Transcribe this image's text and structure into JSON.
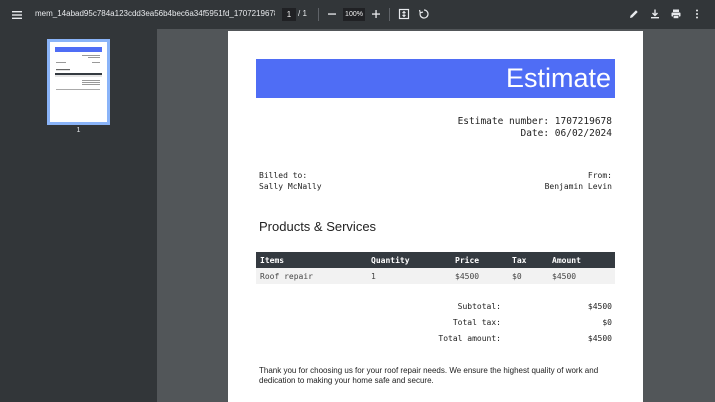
{
  "toolbar": {
    "file_name": "mem_14abad95c784a123cdd3ea56b4bec6a34f5951fd_1707219678...",
    "current_page": "1",
    "page_total": "/ 1",
    "zoom": "100%"
  },
  "sidebar": {
    "thumbnail_label": "1"
  },
  "document": {
    "title": "Estimate",
    "estimate_number_line": "Estimate number: 1707219678",
    "date_line": "Date: 06/02/2024",
    "billed_to_label": "Billed to:",
    "billed_to_name": "Sally McNally",
    "from_label": "From:",
    "from_name": "Benjamin Levin",
    "section_title": "Products & Services",
    "table": {
      "headers": [
        "Items",
        "Quantity",
        "Price",
        "Tax",
        "Amount"
      ],
      "rows": [
        [
          "Roof repair",
          "1",
          "$4500",
          "$0",
          "$4500"
        ]
      ]
    },
    "totals": {
      "subtotal_label": "Subtotal:",
      "subtotal_value": "$4500",
      "tax_label": "Total tax:",
      "tax_value": "$0",
      "amount_label": "Total amount:",
      "amount_value": "$4500"
    },
    "thanks": "Thank you for choosing us for your roof repair needs. We ensure the highest quality of work and dedication to making your home safe and secure."
  }
}
